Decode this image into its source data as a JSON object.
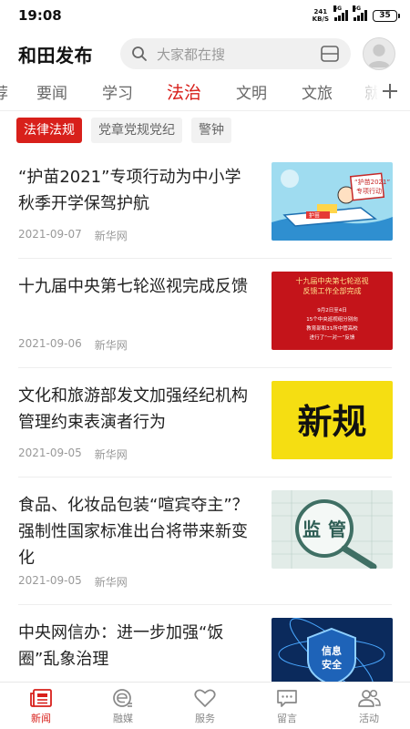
{
  "status_bar": {
    "time": "19:08",
    "net_speed_value": "241",
    "net_speed_unit": "KB/S",
    "signal_1": "4G",
    "signal_2": "4G",
    "battery": "35"
  },
  "header": {
    "brand": "和田发布",
    "search_placeholder": "大家都在搜"
  },
  "tabs": [
    {
      "label": "荐"
    },
    {
      "label": "要闻"
    },
    {
      "label": "学习"
    },
    {
      "label": "法治"
    },
    {
      "label": "文明"
    },
    {
      "label": "文旅"
    },
    {
      "label": "就"
    }
  ],
  "subtabs": [
    {
      "label": "法律法规"
    },
    {
      "label": "党章党规党纪"
    },
    {
      "label": "警钟"
    }
  ],
  "news": [
    {
      "title": "“护苗2021”专项行动为中小学秋季开学保驾护航",
      "date": "2021-09-07",
      "source": "新华网",
      "thumb_texts": [
        "“护苗2021”",
        "专项行动",
        "护苗"
      ]
    },
    {
      "title": "十九届中央第七轮巡视完成反馈",
      "date": "2021-09-06",
      "source": "新华网",
      "thumb_texts": [
        "十九届中央第七轮巡视",
        "反馈工作全部完成",
        "9月2日至4日",
        "15个中央巡视组分别向",
        "教育部和31所中管高校",
        "进行了“一对一”反馈"
      ]
    },
    {
      "title": "文化和旅游部发文加强经纪机构管理约束表演者行为",
      "date": "2021-09-05",
      "source": "新华网",
      "thumb_texts": [
        "新规"
      ]
    },
    {
      "title": "食品、化妆品包装“喧宾夺主”？强制性国家标准出台将带来新变化",
      "date": "2021-09-05",
      "source": "新华网",
      "thumb_texts": [
        "监",
        "管"
      ]
    },
    {
      "title": "中央网信办：进一步加强“饭圈”乱象治理",
      "thumb_texts": [
        "信息",
        "安全"
      ]
    }
  ],
  "bottom_nav": [
    {
      "label": "新闻",
      "icon": "newspaper-icon"
    },
    {
      "label": "融媒",
      "icon": "media-e-icon"
    },
    {
      "label": "服务",
      "icon": "heart-icon"
    },
    {
      "label": "留言",
      "icon": "message-icon"
    },
    {
      "label": "活动",
      "icon": "people-icon"
    }
  ],
  "colors": {
    "accent": "#d8201b",
    "text": "#222222",
    "muted": "#999999"
  }
}
